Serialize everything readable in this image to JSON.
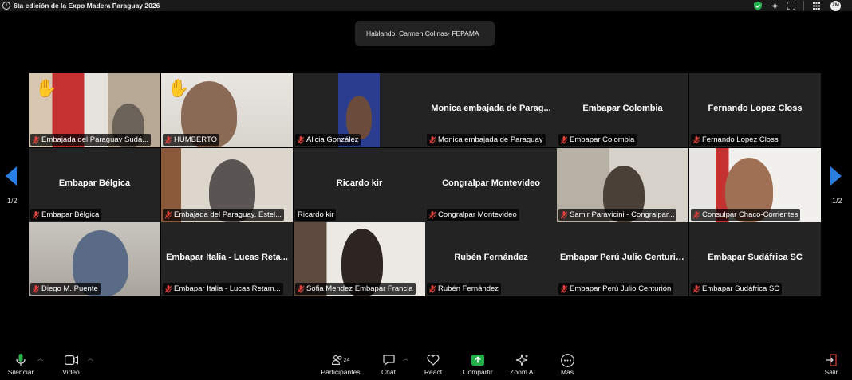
{
  "window": {
    "title": "6ta edición de la Expo Madera Paraguay 2026",
    "info_icon": "info-icon",
    "avatar_initials": "ZM"
  },
  "speaking": {
    "text": "Hablando: Carmen Colinas- FEPAMA"
  },
  "pagination": {
    "left": "1/2",
    "right": "1/2"
  },
  "tiles": [
    {
      "name": "Embajada del Paraguay Sudá...",
      "center": "",
      "video": true,
      "hand": true
    },
    {
      "name": "HUMBERTO",
      "center": "",
      "video": true,
      "hand": true
    },
    {
      "name": "Alicia González",
      "center": "",
      "video": true,
      "hand": false
    },
    {
      "name": "Monica embajada de Paraguay",
      "center": "Monica embajada de Parag...",
      "video": false,
      "hand": false
    },
    {
      "name": "Embapar Colombia",
      "center": "Embapar Colombia",
      "video": false,
      "hand": false
    },
    {
      "name": "Fernando Lopez Closs",
      "center": "Fernando Lopez Closs",
      "video": false,
      "hand": false
    },
    {
      "name": "Embapar Bélgica",
      "center": "Embapar Bélgica",
      "video": false,
      "hand": false
    },
    {
      "name": "Embajada del Paraguay. Estel...",
      "center": "",
      "video": true,
      "hand": false
    },
    {
      "name": "Ricardo kir",
      "center": "Ricardo kir",
      "video": false,
      "hand": false
    },
    {
      "name": "Congralpar Montevideo",
      "center": "Congralpar Montevideo",
      "video": false,
      "hand": false
    },
    {
      "name": "Samir Paravicini - Congralpar...",
      "center": "",
      "video": true,
      "hand": false
    },
    {
      "name": "Consulpar Chaco-Corrientes",
      "center": "",
      "video": true,
      "hand": false
    },
    {
      "name": "Diego M. Puente",
      "center": "",
      "video": true,
      "hand": false
    },
    {
      "name": "Embapar Italia - Lucas Retam...",
      "center": "Embapar Italia - Lucas Reta...",
      "video": false,
      "hand": false
    },
    {
      "name": "Sofia Mendez Embapar Francia",
      "center": "",
      "video": true,
      "hand": false
    },
    {
      "name": "Rubén Fernández",
      "center": "Rubén Fernández",
      "video": false,
      "hand": false
    },
    {
      "name": "Embapar Perú Julio Centurión",
      "center": "Embapar Perú Julio Centurión",
      "video": false,
      "hand": false
    },
    {
      "name": "Embapar Sudáfrica SC",
      "center": "Embapar Sudáfrica SC",
      "video": false,
      "hand": false
    }
  ],
  "toolbar": {
    "mute": "Silenciar",
    "video": "Video",
    "participants": "Participantes",
    "participants_count": "24",
    "chat": "Chat",
    "react": "React",
    "share": "Compartir",
    "zoom_ai": "Zoom AI",
    "more": "Más",
    "leave": "Salir"
  },
  "colors": {
    "accent_blue": "#2a7de1",
    "share_green": "#22b04b",
    "muted_red": "#e0403a",
    "tile_bg": "#232323"
  }
}
